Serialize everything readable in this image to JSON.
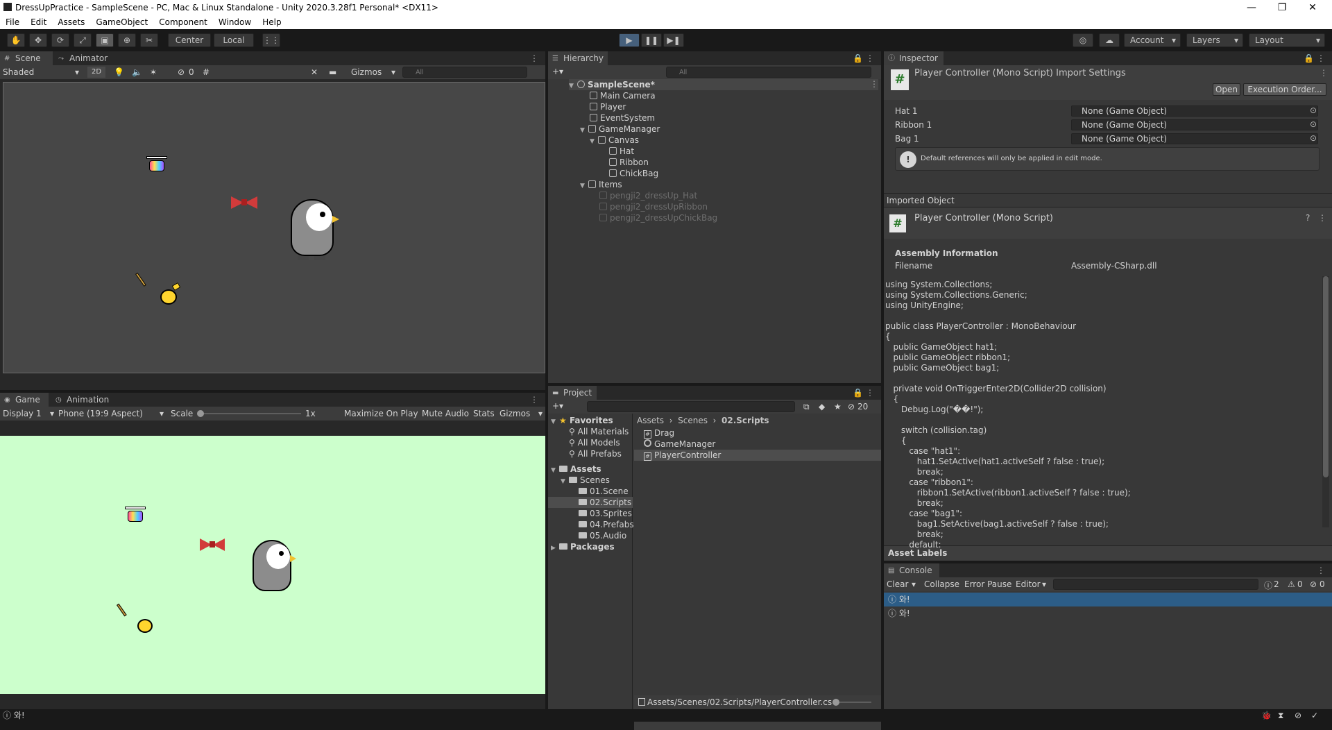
{
  "window": {
    "title": "DressUpPractice - SampleScene - PC, Mac & Linux Standalone - Unity 2020.3.28f1 Personal* <DX11>",
    "controls": [
      "—",
      "❐",
      "✕"
    ]
  },
  "menu": [
    "File",
    "Edit",
    "Assets",
    "GameObject",
    "Component",
    "Window",
    "Help"
  ],
  "toolbar": {
    "pivot": "Center",
    "space": "Local",
    "account": "Account",
    "layers": "Layers",
    "layout": "Layout"
  },
  "scene_panel": {
    "tabs": [
      "Scene",
      "Animator"
    ],
    "shading": "Shaded",
    "mode_2d": "2D",
    "hidden_count": "0",
    "gizmos": "Gizmos",
    "search_placeholder": "All"
  },
  "game_panel": {
    "tabs": [
      "Game",
      "Animation"
    ],
    "display": "Display 1",
    "aspect": "Phone (19:9 Aspect)",
    "scale_label": "Scale",
    "scale_value": "1x",
    "buttons": [
      "Maximize On Play",
      "Mute Audio",
      "Stats",
      "Gizmos"
    ],
    "background": "#ccffcc"
  },
  "hierarchy": {
    "tab": "Hierarchy",
    "search_placeholder": "All",
    "items": [
      {
        "label": "SampleScene*",
        "depth": 0,
        "type": "scene",
        "expanded": true
      },
      {
        "label": "Main Camera",
        "depth": 1,
        "type": "object"
      },
      {
        "label": "Player",
        "depth": 1,
        "type": "object"
      },
      {
        "label": "EventSystem",
        "depth": 1,
        "type": "object"
      },
      {
        "label": "GameManager",
        "depth": 1,
        "type": "object",
        "expanded": true
      },
      {
        "label": "Canvas",
        "depth": 2,
        "type": "object",
        "expanded": true
      },
      {
        "label": "Hat",
        "depth": 3,
        "type": "object"
      },
      {
        "label": "Ribbon",
        "depth": 3,
        "type": "object"
      },
      {
        "label": "ChickBag",
        "depth": 3,
        "type": "object"
      },
      {
        "label": "Items",
        "depth": 1,
        "type": "object",
        "expanded": true
      },
      {
        "label": "pengji2_dressUp_Hat",
        "depth": 2,
        "type": "inactive"
      },
      {
        "label": "pengji2_dressUpRibbon",
        "depth": 2,
        "type": "inactive"
      },
      {
        "label": "pengji2_dressUpChickBag",
        "depth": 2,
        "type": "inactive"
      }
    ]
  },
  "project": {
    "tab": "Project",
    "hidden_count": "20",
    "favorites": {
      "label": "Favorites",
      "items": [
        "All Materials",
        "All Models",
        "All Prefabs"
      ]
    },
    "assets": {
      "label": "Assets",
      "scenes": "Scenes",
      "subfolders": [
        "01.Scene",
        "02.Scripts",
        "03.Sprites",
        "04.Prefabs",
        "05.Audio"
      ]
    },
    "packages": "Packages",
    "breadcrumb": [
      "Assets",
      "Scenes",
      "02.Scripts"
    ],
    "files": [
      "Drag",
      "GameManager",
      "PlayerController"
    ],
    "selected_path": "Assets/Scenes/02.Scripts/PlayerController.cs"
  },
  "inspector": {
    "tab": "Inspector",
    "title": "Player Controller (Mono Script) Import Settings",
    "open_button": "Open",
    "exec_order_button": "Execution Order...",
    "fields": [
      {
        "label": "Hat 1",
        "value": "None (Game Object)"
      },
      {
        "label": "Ribbon 1",
        "value": "None (Game Object)"
      },
      {
        "label": "Bag 1",
        "value": "None (Game Object)"
      }
    ],
    "help_message": "Default references will only be applied in edit mode.",
    "imported_object_label": "Imported Object",
    "imported_object_title": "Player Controller (Mono Script)",
    "assembly_header": "Assembly Information",
    "filename_label": "Filename",
    "filename_value": "Assembly-CSharp.dll",
    "code_lines": [
      "using System.Collections;",
      "using System.Collections.Generic;",
      "using UnityEngine;",
      "",
      "public class PlayerController : MonoBehaviour",
      "{",
      "   public GameObject hat1;",
      "   public GameObject ribbon1;",
      "   public GameObject bag1;",
      "",
      "   private void OnTriggerEnter2D(Collider2D collision)",
      "   {",
      "      Debug.Log(\"��!\");",
      "",
      "      switch (collision.tag)",
      "      {",
      "         case \"hat1\":",
      "            hat1.SetActive(hat1.activeSelf ? false : true);",
      "            break;",
      "         case \"ribbon1\":",
      "            ribbon1.SetActive(ribbon1.activeSelf ? false : true);",
      "            break;",
      "         case \"bag1\":",
      "            bag1.SetActive(bag1.activeSelf ? false : true);",
      "            break;",
      "         default:"
    ],
    "asset_labels": "Asset Labels"
  },
  "console": {
    "tab": "Console",
    "buttons": [
      "Clear",
      "Collapse",
      "Error Pause",
      "Editor"
    ],
    "counts": {
      "log": "2",
      "warn": "0",
      "error": "0"
    },
    "messages": [
      "와!",
      "와!"
    ]
  },
  "statusbar": {
    "message": "와!"
  },
  "colors": {
    "accent": "#2c5d87",
    "play_active": "#46607c",
    "game_bg": "#ccffcc",
    "scene_bg": "#474747"
  }
}
